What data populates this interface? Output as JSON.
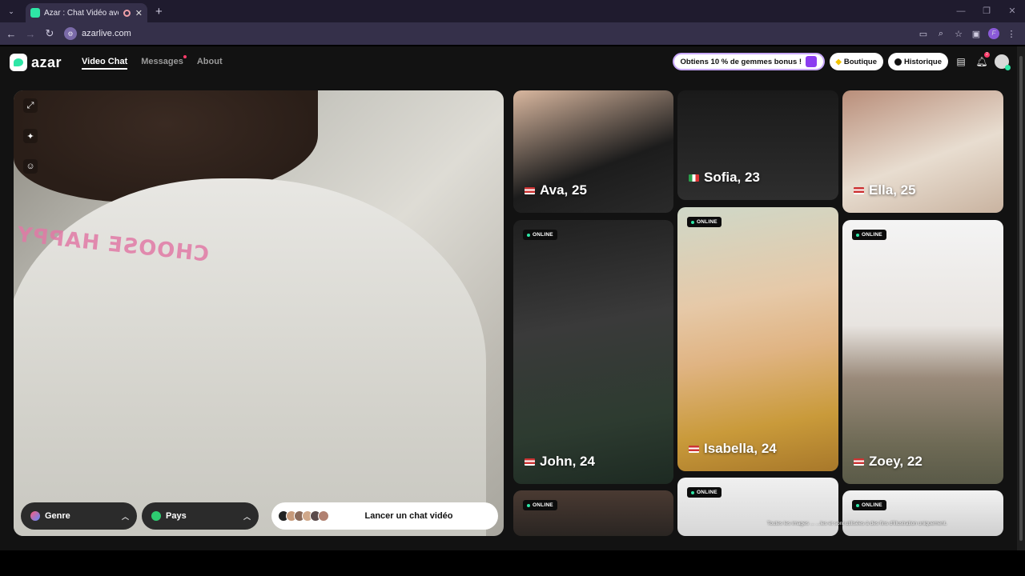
{
  "browser": {
    "tab_title": "Azar : Chat Vidéo avec de r",
    "url": "azarlive.com",
    "profile_initial": "F"
  },
  "header": {
    "logo_text": "azar",
    "nav": [
      {
        "label": "Video Chat",
        "active": true
      },
      {
        "label": "Messages",
        "has_dot": true
      },
      {
        "label": "About"
      }
    ],
    "promo_label": "Obtiens 10 % de gemmes bonus !",
    "shop_label": "Boutique",
    "history_label": "Historique",
    "notif_count": "2"
  },
  "video": {
    "shirt_text": "CHOOSE HAPPY",
    "gender_label": "Genre",
    "country_label": "Pays",
    "start_label": "Lancer un chat vidéo"
  },
  "cards": [
    {
      "name": "Ava, 25",
      "flag": "us",
      "online": false
    },
    {
      "name": "Sofia, 23",
      "flag": "it",
      "online": false
    },
    {
      "name": "Ella, 25",
      "flag": "us",
      "online": false
    },
    {
      "name": "John, 24",
      "flag": "us",
      "online": true
    },
    {
      "name": "Isabella, 24",
      "flag": "us",
      "online": true
    },
    {
      "name": "Zoey, 22",
      "flag": "us",
      "online": true
    },
    {
      "name": "",
      "flag": "",
      "online": true
    },
    {
      "name": "",
      "flag": "",
      "online": true
    },
    {
      "name": "",
      "flag": "",
      "online": true
    }
  ],
  "online_label": "ONLINE",
  "disclaimer": "Toutes les images ... ...les et sont utilisées à des fins d'illustration uniquement."
}
